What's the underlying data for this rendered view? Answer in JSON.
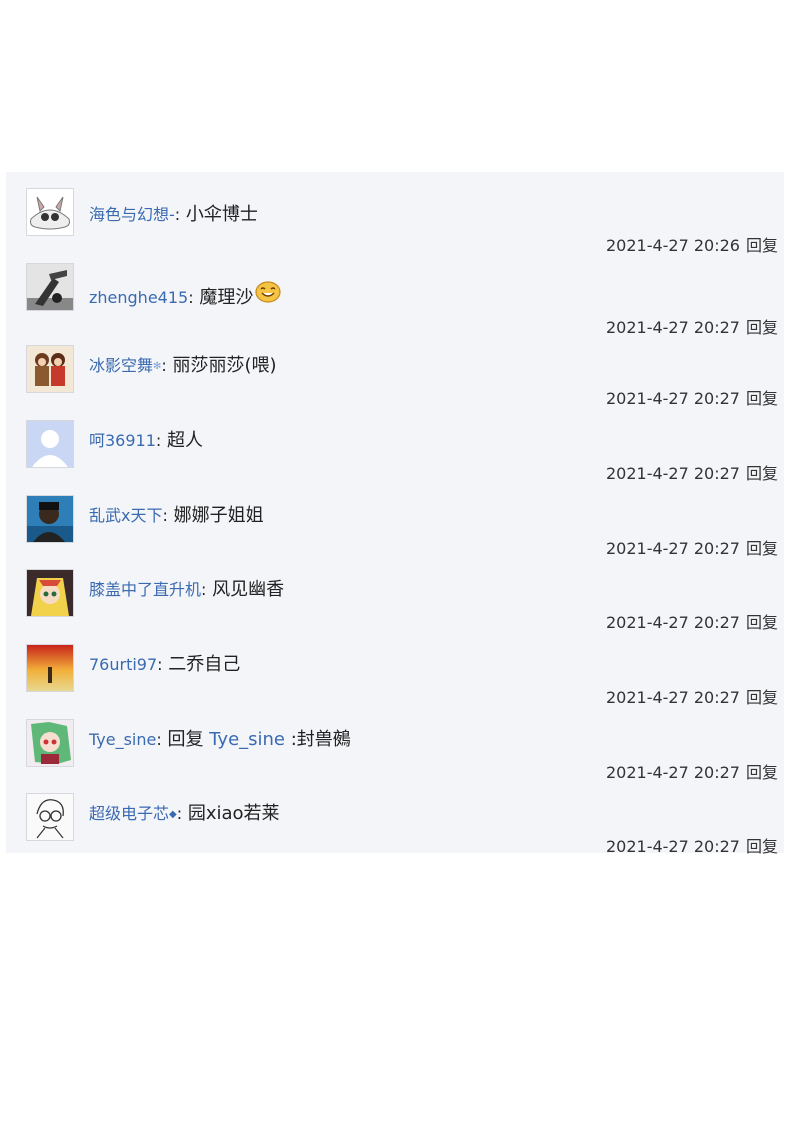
{
  "comments": [
    {
      "user": "海色与幻想-",
      "text": "小伞博士",
      "time": "2021-4-27 20:26",
      "reply": "回复"
    },
    {
      "user": "zhenghe415",
      "text": "魔理沙",
      "time": "2021-4-27 20:27",
      "reply": "回复",
      "emoji": "smiley-emoji"
    },
    {
      "user": "冰影空舞",
      "text": "丽莎丽莎(喂)",
      "time": "2021-4-27 20:27",
      "reply": "回复"
    },
    {
      "user": "呵36911",
      "text": "超人",
      "time": "2021-4-27 20:27",
      "reply": "回复"
    },
    {
      "user": "乱武x天下",
      "text": "娜娜子姐姐",
      "time": "2021-4-27 20:27",
      "reply": "回复"
    },
    {
      "user": "膝盖中了直升机",
      "text": "风见幽香",
      "time": "2021-4-27 20:27",
      "reply": "回复"
    },
    {
      "user": "76urti97",
      "text": "二乔自己",
      "time": "2021-4-27 20:27",
      "reply": "回复"
    },
    {
      "user": "Tye_sine",
      "reply_prefix": "回复",
      "reply_target": "Tye_sine",
      "text": ":封兽鵺",
      "time": "2021-4-27 20:27",
      "reply": "回复"
    },
    {
      "user": "超级电子芯",
      "text": "园xiao若莱",
      "time": "2021-4-27 20:27",
      "reply": "回复"
    }
  ],
  "colon": ":",
  "colors": {
    "username": "#3a6ab0",
    "panel_bg": "#f4f5f9"
  }
}
